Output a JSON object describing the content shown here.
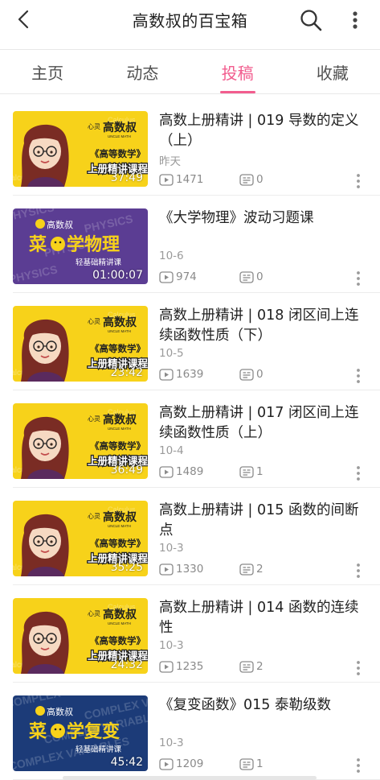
{
  "header": {
    "title": "高数叔的百宝箱"
  },
  "tabs": [
    {
      "label": "主页",
      "active": false
    },
    {
      "label": "动态",
      "active": false
    },
    {
      "label": "投稿",
      "active": true
    },
    {
      "label": "收藏",
      "active": false
    }
  ],
  "colors": {
    "accent": "#f25d8e",
    "thumb_yellow": "#f7d21a",
    "thumb_purple": "#5b3d93",
    "thumb_navy": "#1c3b78"
  },
  "videos": [
    {
      "title": "高数上册精讲 | 019 导数的定义（上）",
      "date": "昨天",
      "plays": "1471",
      "danmaku": "0",
      "duration": "37:49",
      "thumb": {
        "style": "yellow",
        "brand": "高数叔",
        "brand_en": "UNCLE MATH",
        "line1": "《高等数学》",
        "line2": "上册精讲课程"
      }
    },
    {
      "title": "《大学物理》波动习题课",
      "date": "10-6",
      "plays": "974",
      "danmaku": "0",
      "duration": "01:00:07",
      "thumb": {
        "style": "purple",
        "brand": "高数叔",
        "big_left": "菜",
        "big_right": "学物理",
        "sub": "轻基础精讲课"
      }
    },
    {
      "title": "高数上册精讲 | 018 闭区间上连续函数性质（下）",
      "date": "10-5",
      "plays": "1639",
      "danmaku": "0",
      "duration": "23:42",
      "thumb": {
        "style": "yellow",
        "brand": "高数叔",
        "brand_en": "UNCLE MATH",
        "line1": "《高等数学》",
        "line2": "上册精讲课程"
      }
    },
    {
      "title": "高数上册精讲 | 017 闭区间上连续函数性质（上）",
      "date": "10-4",
      "plays": "1489",
      "danmaku": "1",
      "duration": "36:49",
      "thumb": {
        "style": "yellow",
        "brand": "高数叔",
        "brand_en": "UNCLE MATH",
        "line1": "《高等数学》",
        "line2": "上册精讲课程"
      }
    },
    {
      "title": "高数上册精讲 | 015 函数的间断点",
      "date": "10-3",
      "plays": "1330",
      "danmaku": "2",
      "duration": "35:25",
      "thumb": {
        "style": "yellow",
        "brand": "高数叔",
        "brand_en": "UNCLE MATH",
        "line1": "《高等数学》",
        "line2": "上册精讲课程"
      }
    },
    {
      "title": "高数上册精讲 | 014 函数的连续性",
      "date": "10-3",
      "plays": "1235",
      "danmaku": "2",
      "duration": "24:32",
      "thumb": {
        "style": "yellow",
        "brand": "高数叔",
        "brand_en": "UNCLE MATH",
        "line1": "《高等数学》",
        "line2": "上册精讲课程"
      }
    },
    {
      "title": "《复变函数》015 泰勒级数",
      "date": "10-3",
      "plays": "1209",
      "danmaku": "1",
      "duration": "45:42",
      "thumb": {
        "style": "navy",
        "brand": "高数叔",
        "big_left": "菜",
        "big_right": "学复变",
        "sub": "轻基础精讲课"
      }
    }
  ]
}
